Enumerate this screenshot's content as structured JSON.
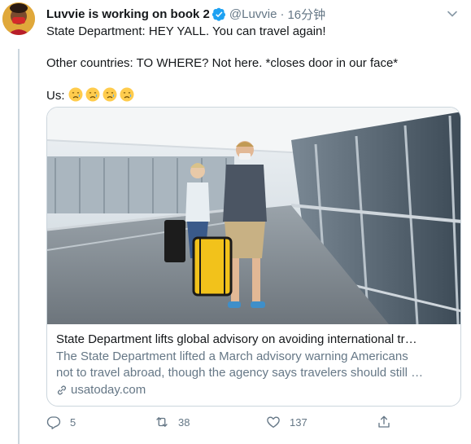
{
  "tweet": {
    "display_name": "Luvvie is working on book 2",
    "verified_icon": "verified-badge-icon",
    "handle": "@Luvvie",
    "separator": "·",
    "timestamp": "16分钟",
    "lines": [
      "State Department: HEY YALL. You can travel again!",
      "Other countries: TO WHERE? Not here. *closes door in our face*",
      "Us:"
    ],
    "emojis": [
      "crying-face-icon",
      "crying-face-icon",
      "crying-face-icon",
      "crying-face-icon"
    ]
  },
  "card": {
    "image_alt": "Travelers wearing face masks walking through an airport walkway with luggage",
    "title": "State Department lifts global advisory on avoiding international tr…",
    "description_lines": [
      "The State Department lifted a March advisory warning Americans",
      "not to travel abroad, though the agency says travelers should still …"
    ],
    "domain": "usatoday.com"
  },
  "actions": {
    "reply_count": "5",
    "retweet_count": "38",
    "like_count": "137"
  },
  "colors": {
    "text": "#14171a",
    "secondary": "#657786",
    "border": "#ccd6dd",
    "verified": "#1da1f2"
  }
}
